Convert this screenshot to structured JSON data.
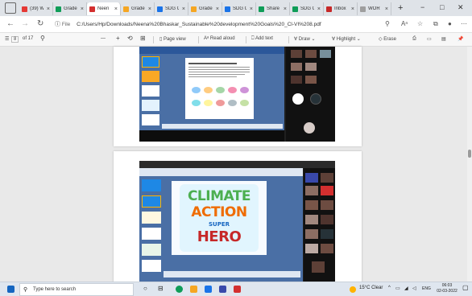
{
  "tabs": [
    {
      "label": "(39) W",
      "color": "#e53935"
    },
    {
      "label": "Grade",
      "color": "#0f9d58"
    },
    {
      "label": "Neen",
      "color": "#d32f2f",
      "active": true
    },
    {
      "label": "Grade",
      "color": "#f5a623"
    },
    {
      "label": "SDG G",
      "color": "#1a73e8"
    },
    {
      "label": "Grade",
      "color": "#f5a623"
    },
    {
      "label": "SDG G",
      "color": "#1a73e8"
    },
    {
      "label": "Share",
      "color": "#0f9d58"
    },
    {
      "label": "SDG G",
      "color": "#0f9d58"
    },
    {
      "label": "Inbox",
      "color": "#c62828"
    },
    {
      "label": "WOR",
      "color": "#9e9e9e"
    }
  ],
  "tab_close": "×",
  "new_tab": "+",
  "window": {
    "minimize": "−",
    "maximize": "□",
    "close": "✕"
  },
  "address": {
    "label": "File",
    "url": "C:/Users/Hp/Downloads/Neena%20Bhaskar_Sustainable%20development%20Goals%20_Cl-VI%208.pdf"
  },
  "pdf_toolbar": {
    "page_number": "8",
    "page_total": "of 17",
    "minus": "—",
    "plus": "+",
    "page_view": "Page view",
    "read_aloud": "Read aloud",
    "add_text": "Add text",
    "draw": "Draw",
    "highlight": "Highlight",
    "erase": "Erase"
  },
  "slide2": {
    "line1": "CLIMATE",
    "line2": "ACTION",
    "line3": "SUPER",
    "line4": "HERO"
  },
  "taskbar": {
    "search_placeholder": "Type here to search",
    "weather": "15°C  Clear",
    "lang": "ENG",
    "time": "06:03",
    "date": "02-03-2022"
  }
}
